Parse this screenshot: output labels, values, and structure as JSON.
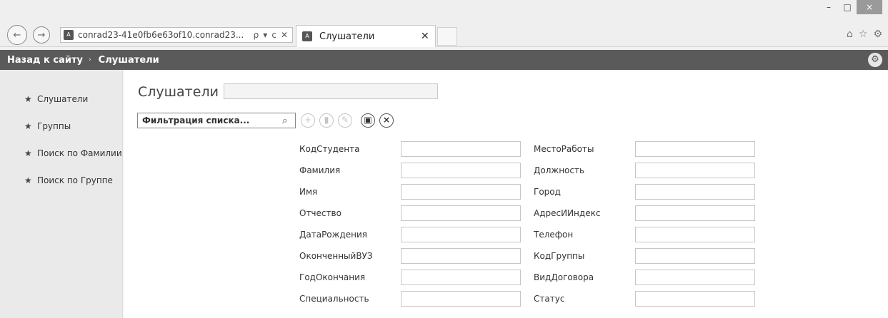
{
  "browser": {
    "url": "conrad23-41e0fb6e63of10.conrad23...",
    "address_tools": [
      "ρ",
      "▾",
      "ᴄ",
      "✕"
    ],
    "tab_title": "Слушатели",
    "window_controls": [
      "–",
      "□",
      "×"
    ]
  },
  "appbar": {
    "back_label": "Назад к сайту",
    "separator": "›",
    "current": "Слушатели"
  },
  "sidebar": {
    "items": [
      {
        "label": "Слушатели"
      },
      {
        "label": "Группы"
      },
      {
        "label": "Поиск по Фамилии"
      },
      {
        "label": "Поиск по Группе"
      }
    ]
  },
  "main": {
    "title": "Слушатели",
    "filter_placeholder": "Фильтрация списка...",
    "action_icons": [
      "add-icon",
      "delete-icon",
      "edit-icon",
      "save-icon",
      "cancel-icon"
    ],
    "left_fields": [
      "КодСтудента",
      "Фамилия",
      "Имя",
      "Отчество",
      "ДатаРождения",
      "ОконченныйВУЗ",
      "ГодОкончания",
      "Специальность"
    ],
    "right_fields": [
      "МестоРаботы",
      "Должность",
      "Город",
      "АдресИИндекс",
      "Телефон",
      "КодГруппы",
      "ВидДоговора",
      "Статус"
    ]
  }
}
